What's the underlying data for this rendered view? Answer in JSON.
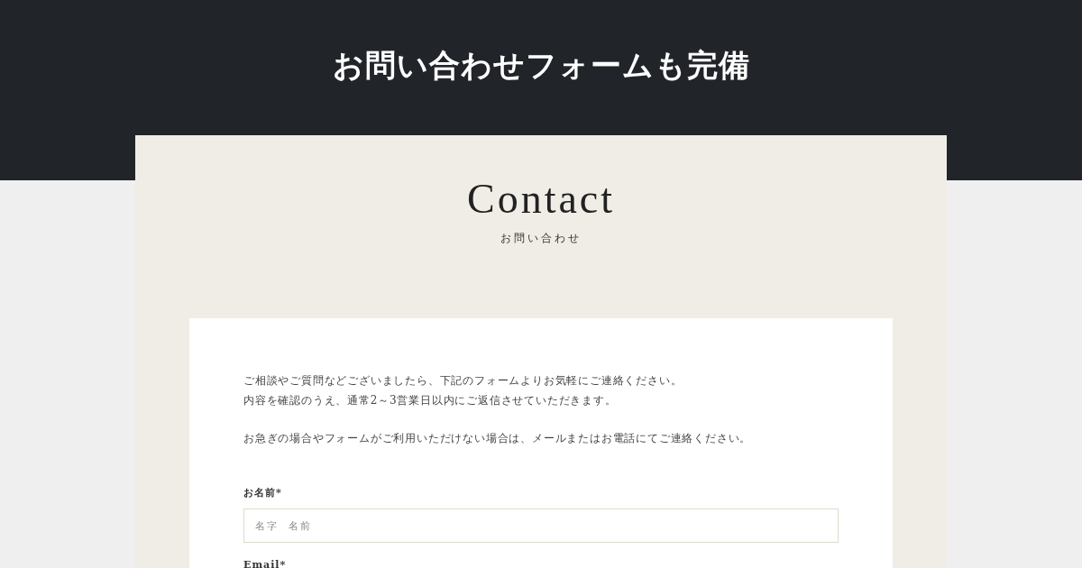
{
  "banner": {
    "title": "お問い合わせフォームも完備"
  },
  "contact": {
    "heading": "Contact",
    "subheading": "お問い合わせ",
    "intro": [
      "ご相談やご質問などございましたら、下記のフォームよりお気軽にご連絡ください。",
      "内容を確認のうえ、通常2～3営業日以内にご返信させていただきます。"
    ],
    "note": "お急ぎの場合やフォームがご利用いただけない場合は、メールまたはお電話にてご連絡ください。",
    "fields": [
      {
        "label": "お名前*",
        "placeholder": "名字  名前"
      },
      {
        "label": "Email*"
      }
    ]
  }
}
